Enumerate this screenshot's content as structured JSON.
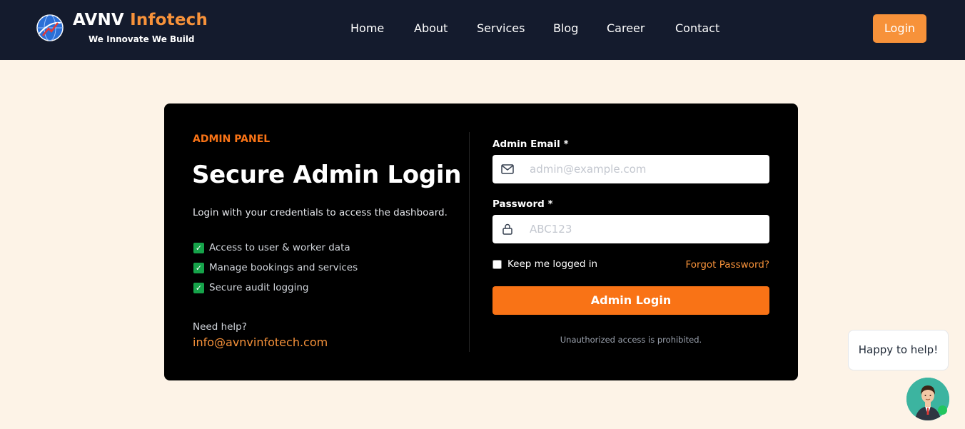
{
  "brand": {
    "name_main": "AVNV",
    "name_accent": "Infotech",
    "tagline": "We Innovate We Build",
    "accent_color": "#f7923a"
  },
  "nav": {
    "links": [
      "Home",
      "About",
      "Services",
      "Blog",
      "Career",
      "Contact"
    ],
    "login_label": "Login"
  },
  "panel": {
    "eyebrow": "ADMIN PANEL",
    "title": "Secure Admin Login",
    "subtitle": "Login with your credentials to access the dashboard.",
    "features": [
      "Access to user & worker data",
      "Manage bookings and services",
      "Secure audit logging"
    ],
    "help_label": "Need help?",
    "help_email": "info@avnvinfotech.com"
  },
  "form": {
    "email_label": "Admin Email *",
    "email_placeholder": "admin@example.com",
    "email_icon": "mail-icon",
    "password_label": "Password *",
    "password_placeholder": "ABC123",
    "password_icon": "lock-icon",
    "remember_label": "Keep me logged in",
    "remember_checked": false,
    "forgot_label": "Forgot Password?",
    "submit_label": "Admin Login",
    "submit_color": "#f97316",
    "warning": "Unauthorized access is prohibited."
  },
  "chat": {
    "bubble_text": "Happy to help!",
    "status": "online"
  }
}
